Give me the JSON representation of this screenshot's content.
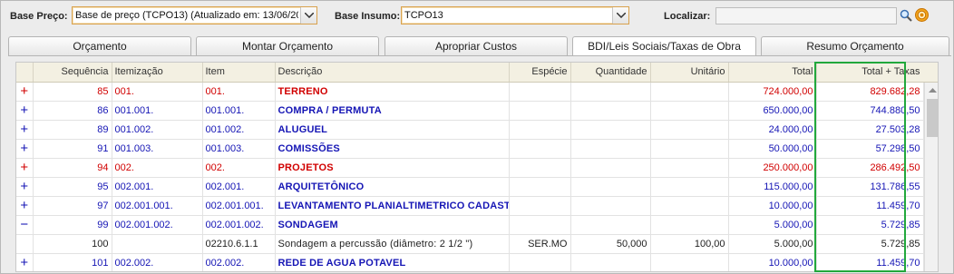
{
  "toolbar": {
    "base_preco_label": "Base Preço:",
    "base_preco_value": "Base de preço (TCPO13) (Atualizado em: 13/06/20",
    "base_insumo_label": "Base Insumo:",
    "base_insumo_value": "TCPO13",
    "localizar_label": "Localizar:",
    "localizar_value": ""
  },
  "tabs": [
    {
      "label": "Orçamento"
    },
    {
      "label": "Montar Orçamento"
    },
    {
      "label": "Apropriar Custos"
    },
    {
      "label": "BDI/Leis Sociais/Taxas de Obra"
    },
    {
      "label": "Resumo Orçamento"
    }
  ],
  "active_tab": "BDI/Leis Sociais/Taxas de Obra",
  "grid": {
    "columns": [
      "Sequência",
      "Itemização",
      "Item",
      "Descrição",
      "Espécie",
      "Quantidade",
      "Unitário",
      "Total",
      "Total + Taxas"
    ],
    "rows": [
      {
        "exp": "+",
        "seq": "85",
        "itemizacao": "001.",
        "item": "001.",
        "descricao": "TERRENO",
        "especie": "",
        "quantidade": "",
        "unitario": "",
        "total": "724.000,00",
        "total_taxas": "829.682,28",
        "style": "red"
      },
      {
        "exp": "+",
        "seq": "86",
        "itemizacao": "001.001.",
        "item": "001.001.",
        "descricao": "COMPRA / PERMUTA",
        "especie": "",
        "quantidade": "",
        "unitario": "",
        "total": "650.000,00",
        "total_taxas": "744.880,50",
        "style": "blue"
      },
      {
        "exp": "+",
        "seq": "89",
        "itemizacao": "001.002.",
        "item": "001.002.",
        "descricao": "ALUGUEL",
        "especie": "",
        "quantidade": "",
        "unitario": "",
        "total": "24.000,00",
        "total_taxas": "27.503,28",
        "style": "blue"
      },
      {
        "exp": "+",
        "seq": "91",
        "itemizacao": "001.003.",
        "item": "001.003.",
        "descricao": "COMISSÕES",
        "especie": "",
        "quantidade": "",
        "unitario": "",
        "total": "50.000,00",
        "total_taxas": "57.298,50",
        "style": "blue"
      },
      {
        "exp": "+",
        "seq": "94",
        "itemizacao": "002.",
        "item": "002.",
        "descricao": "PROJETOS",
        "especie": "",
        "quantidade": "",
        "unitario": "",
        "total": "250.000,00",
        "total_taxas": "286.492,50",
        "style": "red"
      },
      {
        "exp": "+",
        "seq": "95",
        "itemizacao": "002.001.",
        "item": "002.001.",
        "descricao": "ARQUITETÔNICO",
        "especie": "",
        "quantidade": "",
        "unitario": "",
        "total": "115.000,00",
        "total_taxas": "131.786,55",
        "style": "blue"
      },
      {
        "exp": "+",
        "seq": "97",
        "itemizacao": "002.001.001.",
        "item": "002.001.001.",
        "descricao": "LEVANTAMENTO PLANIALTIMETRICO CADASTRAL",
        "especie": "",
        "quantidade": "",
        "unitario": "",
        "total": "10.000,00",
        "total_taxas": "11.459,70",
        "style": "blue"
      },
      {
        "exp": "−",
        "seq": "99",
        "itemizacao": "002.001.002.",
        "item": "002.001.002.",
        "descricao": "SONDAGEM",
        "especie": "",
        "quantidade": "",
        "unitario": "",
        "total": "5.000,00",
        "total_taxas": "5.729,85",
        "style": "blue"
      },
      {
        "exp": "",
        "seq": "100",
        "itemizacao": "",
        "item": "02210.6.1.1",
        "descricao": "Sondagem a percussão (diâmetro: 2 1/2 \")",
        "especie": "SER.MO",
        "quantidade": "50,000",
        "unitario": "100,00",
        "total": "5.000,00",
        "total_taxas": "5.729,85",
        "style": "plain"
      },
      {
        "exp": "+",
        "seq": "101",
        "itemizacao": "002.002.",
        "item": "002.002.",
        "descricao": "REDE DE AGUA POTAVEL",
        "especie": "",
        "quantidade": "",
        "unitario": "",
        "total": "10.000,00",
        "total_taxas": "11.459,70",
        "style": "blue"
      }
    ]
  },
  "colors": {
    "red": "#d10000",
    "blue": "#1515b5",
    "highlight": "#22a83c",
    "combo_border": "#d9a24e"
  },
  "icons": [
    "magnifier-icon",
    "settings-gear-icon",
    "dropdown-arrow-icon",
    "scroll-up-arrow-icon"
  ]
}
